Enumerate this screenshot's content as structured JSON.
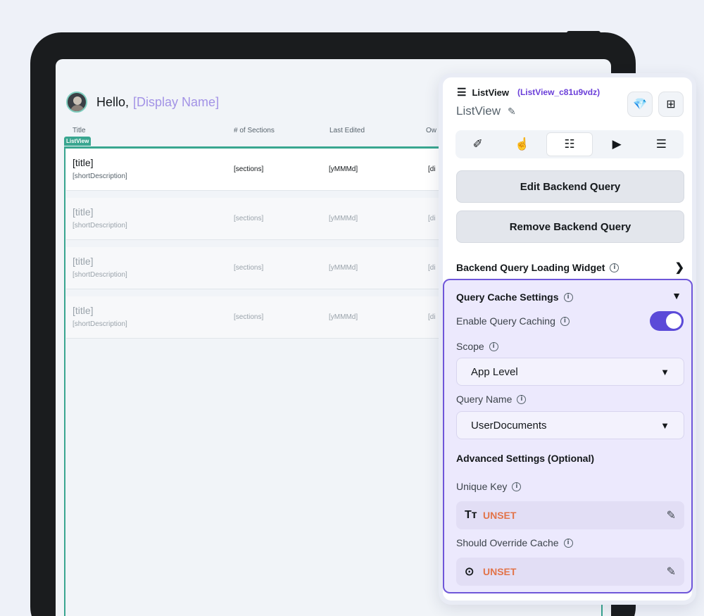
{
  "app": {
    "greeting": "Hello,",
    "display_name": "[Display Name]",
    "columns": [
      "Title",
      "# of Sections",
      "Last Edited",
      "Ow"
    ],
    "listview_tag": "ListView",
    "rows": [
      {
        "title": "[title]",
        "desc": "[shortDescription]",
        "sections": "[sections]",
        "edited": "[yMMMd]",
        "owner": "[di"
      },
      {
        "title": "[title]",
        "desc": "[shortDescription]",
        "sections": "[sections]",
        "edited": "[yMMMd]",
        "owner": "[di"
      },
      {
        "title": "[title]",
        "desc": "[shortDescription]",
        "sections": "[sections]",
        "edited": "[yMMMd]",
        "owner": "[di"
      },
      {
        "title": "[title]",
        "desc": "[shortDescription]",
        "sections": "[sections]",
        "edited": "[yMMMd]",
        "owner": "[di"
      }
    ]
  },
  "panel": {
    "widget_type": "ListView",
    "widget_id": "(ListView_c81u9vdz)",
    "widget_name": "ListView",
    "edit_query_label": "Edit Backend Query",
    "remove_query_label": "Remove Backend Query",
    "loading_widget_label": "Backend Query Loading Widget",
    "cache": {
      "title": "Query Cache Settings",
      "enable_label": "Enable Query Caching",
      "enabled": true,
      "scope_label": "Scope",
      "scope_value": "App Level",
      "query_name_label": "Query Name",
      "query_name_value": "UserDocuments",
      "advanced_label": "Advanced Settings (Optional)",
      "unique_key_label": "Unique Key",
      "unique_key_value": "UNSET",
      "override_label": "Should Override Cache",
      "override_value": "UNSET"
    }
  },
  "colors": {
    "accent": "#5b4ad8",
    "listview": "#39a690",
    "unset": "#e2744a",
    "cache_bg": "#ece9fd"
  }
}
